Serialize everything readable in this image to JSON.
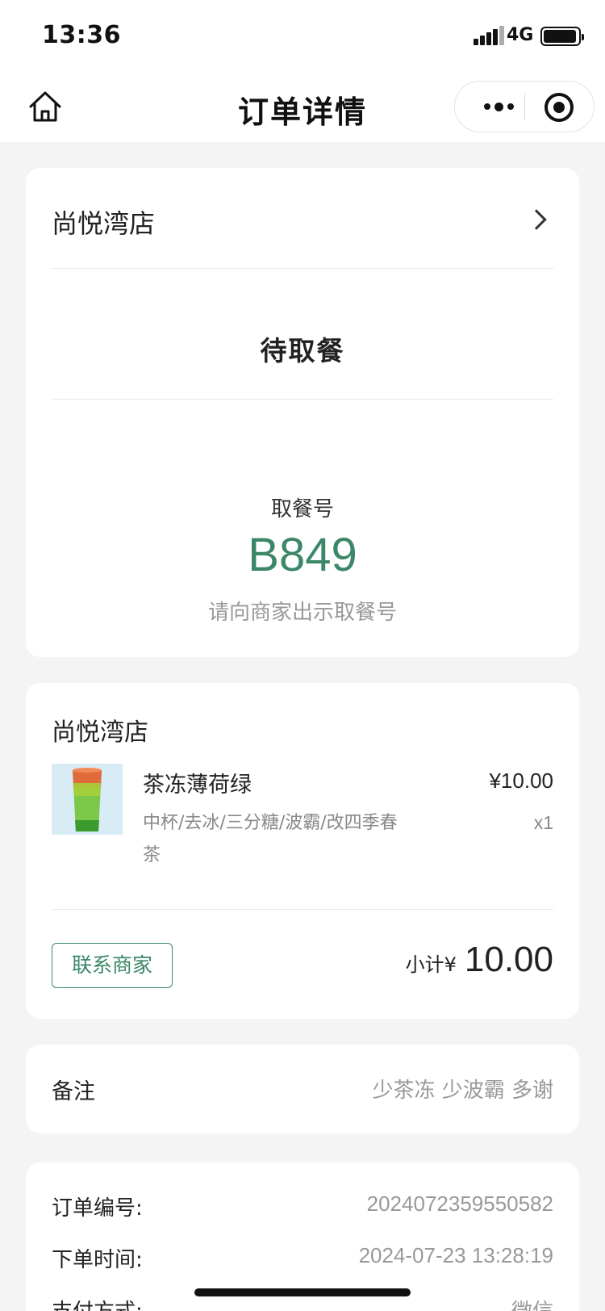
{
  "status_bar": {
    "time": "13:36",
    "network": "4G"
  },
  "nav": {
    "title": "订单详情"
  },
  "pickup_card": {
    "store_name": "尚悦湾店",
    "status": "待取餐",
    "pickup_label": "取餐号",
    "pickup_number": "B849",
    "hint": "请向商家出示取餐号"
  },
  "order_card": {
    "store_name": "尚悦湾店",
    "item": {
      "name": "茶冻薄荷绿",
      "price": "¥10.00",
      "spec": "中杯/去冰/三分糖/波霸/改四季春茶",
      "qty": "x1"
    },
    "contact_label": "联系商家",
    "subtotal_label": "小计¥",
    "subtotal_value": "10.00"
  },
  "note_card": {
    "label": "备注",
    "value": "少茶冻 少波霸 多谢"
  },
  "info_card": {
    "rows": [
      {
        "key": "订单编号:",
        "value": "2024072359550582"
      },
      {
        "key": "下单时间:",
        "value": "2024-07-23 13:28:19"
      },
      {
        "key": "支付方式:",
        "value": "微信"
      }
    ]
  },
  "icons": [
    "home-icon",
    "more-icon",
    "target-icon",
    "chevron-right-icon",
    "signal-icon",
    "battery-icon"
  ]
}
